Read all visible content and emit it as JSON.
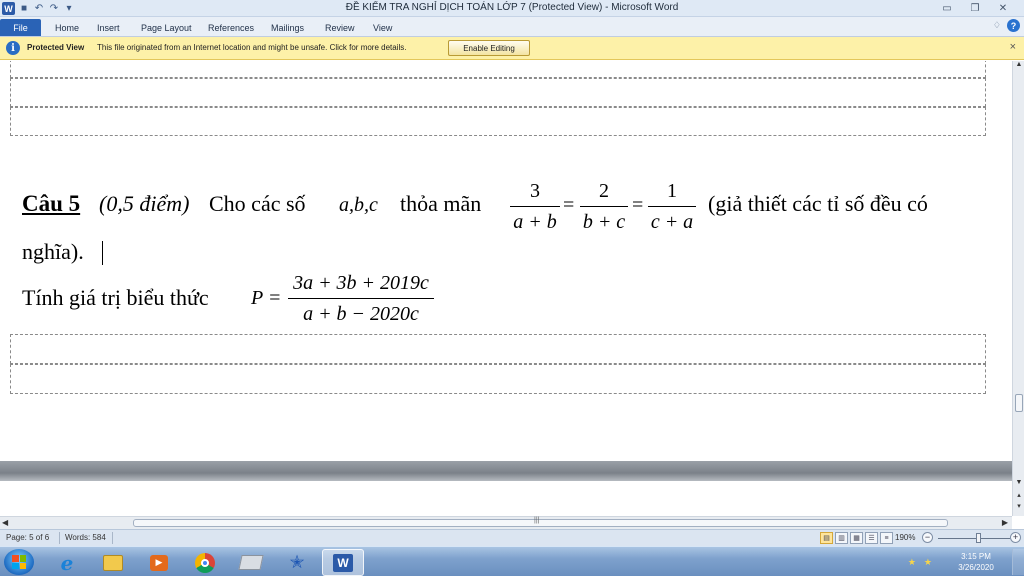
{
  "window": {
    "title": "ĐỀ KIỂM TRA NGHỈ DỊCH TOÁN  LỚP 7 (Protected View) - Microsoft Word",
    "app_badge": "W"
  },
  "ribbon": {
    "tabs": [
      "File",
      "Home",
      "Insert",
      "Page Layout",
      "References",
      "Mailings",
      "Review",
      "View"
    ]
  },
  "protected_view": {
    "title": "Protected View",
    "message": "This file originated from an Internet location and might be unsafe. Click for more details.",
    "button": "Enable Editing",
    "close": "×"
  },
  "document": {
    "q_label": "Câu 5",
    "points": "(0,5 điểm)",
    "intro": "Cho các số",
    "vars": "a,b,c",
    "satisfy": "thỏa mãn",
    "f1_num": "3",
    "f1_den": "a + b",
    "f2_num": "2",
    "f2_den": "b + c",
    "f3_num": "1",
    "f3_den": "c + a",
    "eq_sign": "=",
    "assumption": "(giả thiết các tỉ số đều có",
    "line2": "nghĩa).",
    "line3": "Tính giá trị biểu thức",
    "p_lhs": "P =",
    "p_num": "3a + 3b + 2019c",
    "p_den": "a + b − 2020c"
  },
  "statusbar": {
    "page": "Page: 5 of 6",
    "words": "Words: 584",
    "zoom": "190%"
  },
  "taskbar": {
    "time": "3:15 PM",
    "date": "3/26/2020"
  },
  "colors": {
    "file_tab": "#2a63b6",
    "protected_bar": "#fdf1a8",
    "taskbar": "#7ea1cd"
  }
}
